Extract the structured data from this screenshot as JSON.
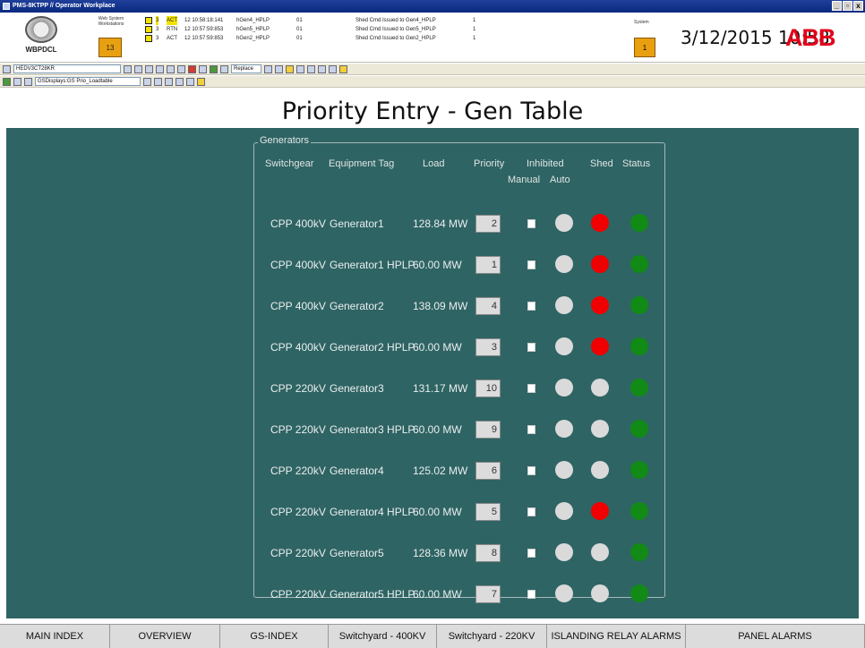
{
  "window": {
    "title": "PMS-8KTPP // Operator Workplace"
  },
  "header": {
    "logo_text": "WBPDCL",
    "ws_label": "Web System Workstations",
    "ws_count": "13",
    "alarms": [
      {
        "pri": "3",
        "ack": "ACT",
        "time": "12 10:58:18:141",
        "tag": "hGen4_HPLP",
        "num": "01",
        "msg": "Shed Cmd Issued to Gen4_HPLP",
        "val": "1",
        "highlight": true
      },
      {
        "pri": "3",
        "ack": "RTN",
        "time": "12 10:57:59:853",
        "tag": "hGen5_HPLP",
        "num": "01",
        "msg": "Shed Cmd Issued to Gen5_HPLP",
        "val": "1",
        "highlight": false
      },
      {
        "pri": "3",
        "ack": "ACT",
        "time": "12 10:57:59:853",
        "tag": "hGen2_HPLP",
        "num": "01",
        "msg": "Shed Cmd Issued to Gen2_HPLP",
        "val": "1",
        "highlight": false
      }
    ],
    "system_label": "System",
    "system_count": "1",
    "datetime": "3/12/2015 10:58",
    "brand": "ABB"
  },
  "toolbar": {
    "workplace_combo": "HEDV3CT28KR",
    "replace_combo": "Replace",
    "display_path": "GSDisplays:GS Prio_Loadtable"
  },
  "page": {
    "title": "Priority Entry - Gen Table"
  },
  "generators": {
    "group_title": "Generators",
    "columns": {
      "switchgear": "Switchgear",
      "equipment_tag": "Equipment Tag",
      "load": "Load",
      "priority": "Priority",
      "inhibited": "Inhibited",
      "manual": "Manual",
      "auto": "Auto",
      "shed": "Shed",
      "status": "Status"
    },
    "rows": [
      {
        "switchgear": "CPP 400kV",
        "tag": "Generator1",
        "load": "128.84 MW",
        "priority": "2",
        "shed": "red"
      },
      {
        "switchgear": "CPP 400kV",
        "tag": "Generator1 HPLP",
        "load": "60.00 MW",
        "priority": "1",
        "shed": "red"
      },
      {
        "switchgear": "CPP 400kV",
        "tag": "Generator2",
        "load": "138.09 MW",
        "priority": "4",
        "shed": "red"
      },
      {
        "switchgear": "CPP 400kV",
        "tag": "Generator2 HPLP",
        "load": "60.00 MW",
        "priority": "3",
        "shed": "red"
      },
      {
        "switchgear": "CPP 220kV",
        "tag": "Generator3",
        "load": "131.17 MW",
        "priority": "10",
        "shed": "grey"
      },
      {
        "switchgear": "CPP 220kV",
        "tag": "Generator3 HPLP",
        "load": "60.00 MW",
        "priority": "9",
        "shed": "grey"
      },
      {
        "switchgear": "CPP 220kV",
        "tag": "Generator4",
        "load": "125.02 MW",
        "priority": "6",
        "shed": "grey"
      },
      {
        "switchgear": "CPP 220kV",
        "tag": "Generator4 HPLP",
        "load": "60.00 MW",
        "priority": "5",
        "shed": "red"
      },
      {
        "switchgear": "CPP 220kV",
        "tag": "Generator5",
        "load": "128.36 MW",
        "priority": "8",
        "shed": "grey"
      },
      {
        "switchgear": "CPP 220kV",
        "tag": "Generator5 HPLP",
        "load": "60.00 MW",
        "priority": "7",
        "shed": "grey"
      }
    ]
  },
  "nav": [
    "MAIN INDEX",
    "OVERVIEW",
    "GS-INDEX",
    "Switchyard - 400KV",
    "Switchyard - 220KV",
    "ISLANDING RELAY ALARMS",
    "PANEL ALARMS"
  ]
}
